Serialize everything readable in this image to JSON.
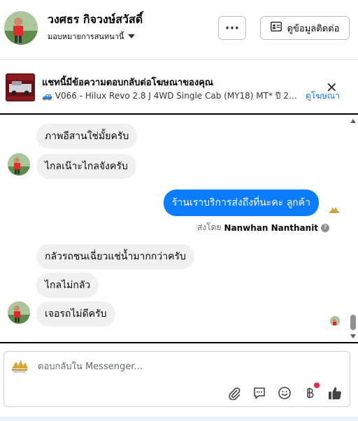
{
  "header": {
    "user_name": "วงศธร กิจวงษ์สวัสดิ์",
    "assign_label": "มอบหมายการสนทนานี้",
    "more_label": "···",
    "contact_button_label": "ดูข้อมูลติดต่อ"
  },
  "ad": {
    "title": "แชทนี้มีข้อความตอบกลับต่อโฆษณาของคุณ",
    "subtitle": "🚙 V066 - Hilux Revo 2.8 J 4WD Single Cab (MY18) MT* ปี 2018 ...",
    "close_label": "✕",
    "link_label": "ดูโฆษณา"
  },
  "thread": {
    "messages": [
      {
        "text": "ภาพอีสานใช่มั้ยครับ"
      },
      {
        "text": "ไกลเน๊าะไกลจังครับ"
      },
      {
        "text": "ร้านเราบริการส่งถึงที่นะคะ  ลูกค้า"
      },
      {
        "text": "กลัวรถชนเฉี่ยวแช่น้ำมากกว่าครับ"
      },
      {
        "text": "ไกลไม่กลัว"
      },
      {
        "text": "เจอรถไม่ดีครับ"
      }
    ],
    "sent_by_prefix": "ส่งโดย",
    "sent_by_name": "Nanwhan Nanthanit",
    "info_icon_label": "?"
  },
  "composer": {
    "placeholder": "ตอบกลับใน Messenger..."
  },
  "colors": {
    "outgoing_bubble": "#0a7cff",
    "incoming_bubble": "#f0f0f0",
    "link": "#1877f2",
    "notification_dot": "#f02849"
  },
  "icons": [
    "ellipsis-icon",
    "contact-card-icon",
    "close-icon",
    "paperclip-icon",
    "chat-bubble-icon",
    "emoji-icon",
    "baht-icon",
    "thumbs-up-icon",
    "info-icon"
  ]
}
